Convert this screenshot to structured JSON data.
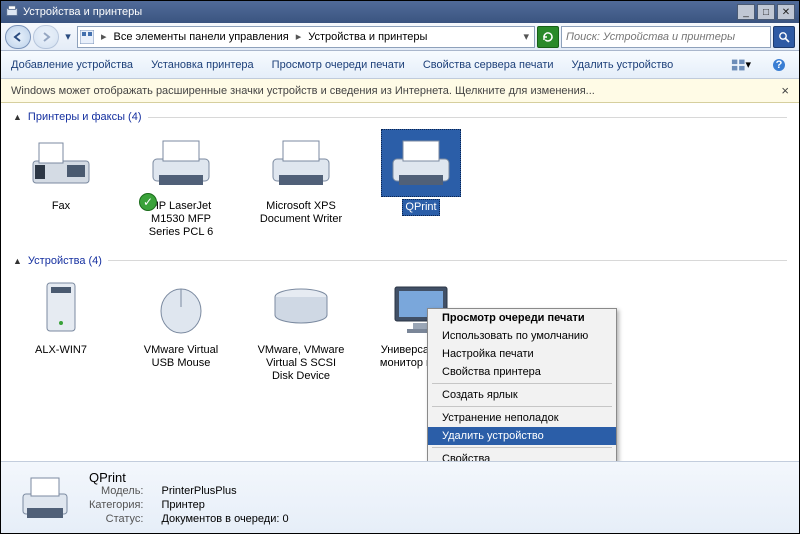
{
  "window": {
    "title": "Устройства и принтеры"
  },
  "nav": {
    "crumb1": "Все элементы панели управления",
    "crumb2": "Устройства и принтеры",
    "search_placeholder": "Поиск: Устройства и принтеры"
  },
  "toolbar": {
    "add_device": "Добавление устройства",
    "add_printer": "Установка принтера",
    "view_queue": "Просмотр очереди печати",
    "server_props": "Свойства сервера печати",
    "remove_device": "Удалить устройство"
  },
  "infobar": {
    "text": "Windows может отображать расширенные значки устройств и сведения из Интернета.   Щелкните для изменения..."
  },
  "groups": {
    "printers": {
      "title": "Принтеры и факсы (4)"
    },
    "devices": {
      "title": "Устройства (4)"
    }
  },
  "printers": [
    {
      "label": "Fax"
    },
    {
      "label": "HP LaserJet M1530 MFP Series PCL 6",
      "default": true
    },
    {
      "label": "Microsoft XPS Document Writer"
    },
    {
      "label": "QPrint",
      "selected": true
    }
  ],
  "devices": [
    {
      "label": "ALX-WIN7"
    },
    {
      "label": "VMware Virtual USB Mouse"
    },
    {
      "label": "VMware, VMware Virtual S SCSI Disk Device"
    },
    {
      "label": "Универсальный монитор не PnP"
    }
  ],
  "context_menu": {
    "view_queue": "Просмотр очереди печати",
    "set_default": "Использовать по умолчанию",
    "print_prefs": "Настройка печати",
    "printer_props": "Свойства принтера",
    "create_shortcut": "Создать ярлык",
    "troubleshoot": "Устранение неполадок",
    "remove_device": "Удалить устройство",
    "properties": "Свойства"
  },
  "details": {
    "name": "QPrint",
    "model_k": "Модель:",
    "model_v": "PrinterPlusPlus",
    "cat_k": "Категория:",
    "cat_v": "Принтер",
    "status_k": "Статус:",
    "status_v": "Документов в очереди: 0"
  }
}
